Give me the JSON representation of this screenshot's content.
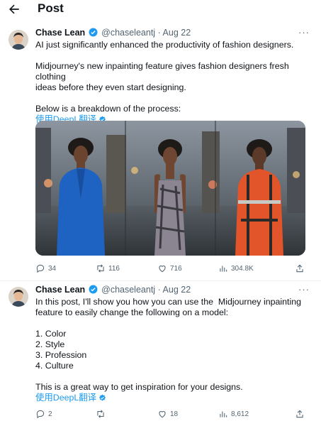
{
  "header": {
    "title": "Post"
  },
  "tweets": [
    {
      "author": {
        "name": "Chase Lean",
        "handle": "@chaseleantj",
        "separator": "·",
        "date": "Aug 22"
      },
      "lines": [
        "AI just significantly enhanced the productivity of fashion designers.",
        "",
        "Midjourney's new inpainting feature gives fashion designers fresh clothing",
        "ideas before they even start designing.",
        "",
        "Below is a breakdown of the process:"
      ],
      "translate_label": "使用DeepL翻译",
      "stats": {
        "replies": "34",
        "reposts": "116",
        "likes": "716",
        "views": "304.8K"
      }
    },
    {
      "author": {
        "name": "Chase Lean",
        "handle": "@chaseleantj",
        "separator": "·",
        "date": "Aug 22"
      },
      "lines": [
        "In this post, I'll show you how you can use the  Midjourney inpainting",
        "feature to easily change the following on a model:",
        "",
        "1. Color",
        "2. Style",
        "3. Profession",
        "4. Culture",
        "",
        "This is a great way to get inspiration for your designs."
      ],
      "translate_label": "使用DeepL翻译",
      "stats": {
        "replies": "2",
        "reposts": "",
        "likes": "18",
        "views": "8,612"
      }
    }
  ],
  "icons": {
    "back": "arrow-left-icon",
    "more": "more-horizontal-icon",
    "verified": "verified-badge-icon",
    "reply": "reply-icon",
    "repost": "repost-icon",
    "like": "heart-icon",
    "views": "views-chart-icon",
    "share": "share-icon"
  },
  "colors": {
    "accent": "#1d9bf0",
    "text": "#0f1419",
    "secondary": "#536471",
    "divider": "#eff3f4"
  }
}
